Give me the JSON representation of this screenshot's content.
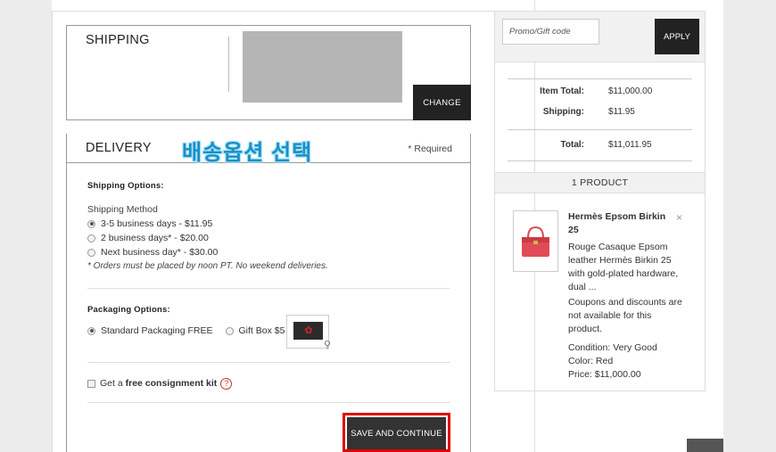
{
  "shipping": {
    "title": "SHIPPING",
    "change_label": "CHANGE"
  },
  "delivery": {
    "title": "DELIVERY",
    "korean_annotation": "배송옵션 선택",
    "required": "* Required",
    "shipping_options": {
      "label": "Shipping Options:",
      "method_label": "Shipping Method",
      "methods": [
        {
          "label": "3-5 business days - $11.95",
          "checked": true
        },
        {
          "label": "2 business days* - $20.00",
          "checked": false
        },
        {
          "label": "Next business day* - $30.00",
          "checked": false
        }
      ],
      "note": "* Orders must be placed by noon PT. No weekend deliveries."
    },
    "packaging": {
      "label": "Packaging Options:",
      "standard": "Standard Packaging FREE",
      "gift": "Gift Box $5"
    },
    "consignment": {
      "prefix": "Get a ",
      "bold": "free consignment kit",
      "help": "?"
    },
    "save_label": "SAVE AND CONTINUE"
  },
  "promo": {
    "placeholder": "Promo/Gift code",
    "apply_label": "APPLY"
  },
  "totals": {
    "item_total_label": "Item Total:",
    "item_total": "$11,000.00",
    "shipping_label": "Shipping:",
    "shipping": "$11.95",
    "total_label": "Total:",
    "total": "$11,011.95"
  },
  "product": {
    "header": "1 PRODUCT",
    "name": "Hermès Epsom Birkin 25",
    "description": "Rouge Casaque Epsom leather Hermès Birkin 25 with gold-plated hardware, dual ...",
    "coupon_note": "Coupons and discounts are not available for this product.",
    "condition": "Condition: Very Good",
    "color": "Color: Red",
    "price": "Price: $11,000.00",
    "close": "×"
  },
  "colors": {
    "accent": "#222222",
    "highlight": "#e00000",
    "annotation": "#1d8fc4"
  }
}
